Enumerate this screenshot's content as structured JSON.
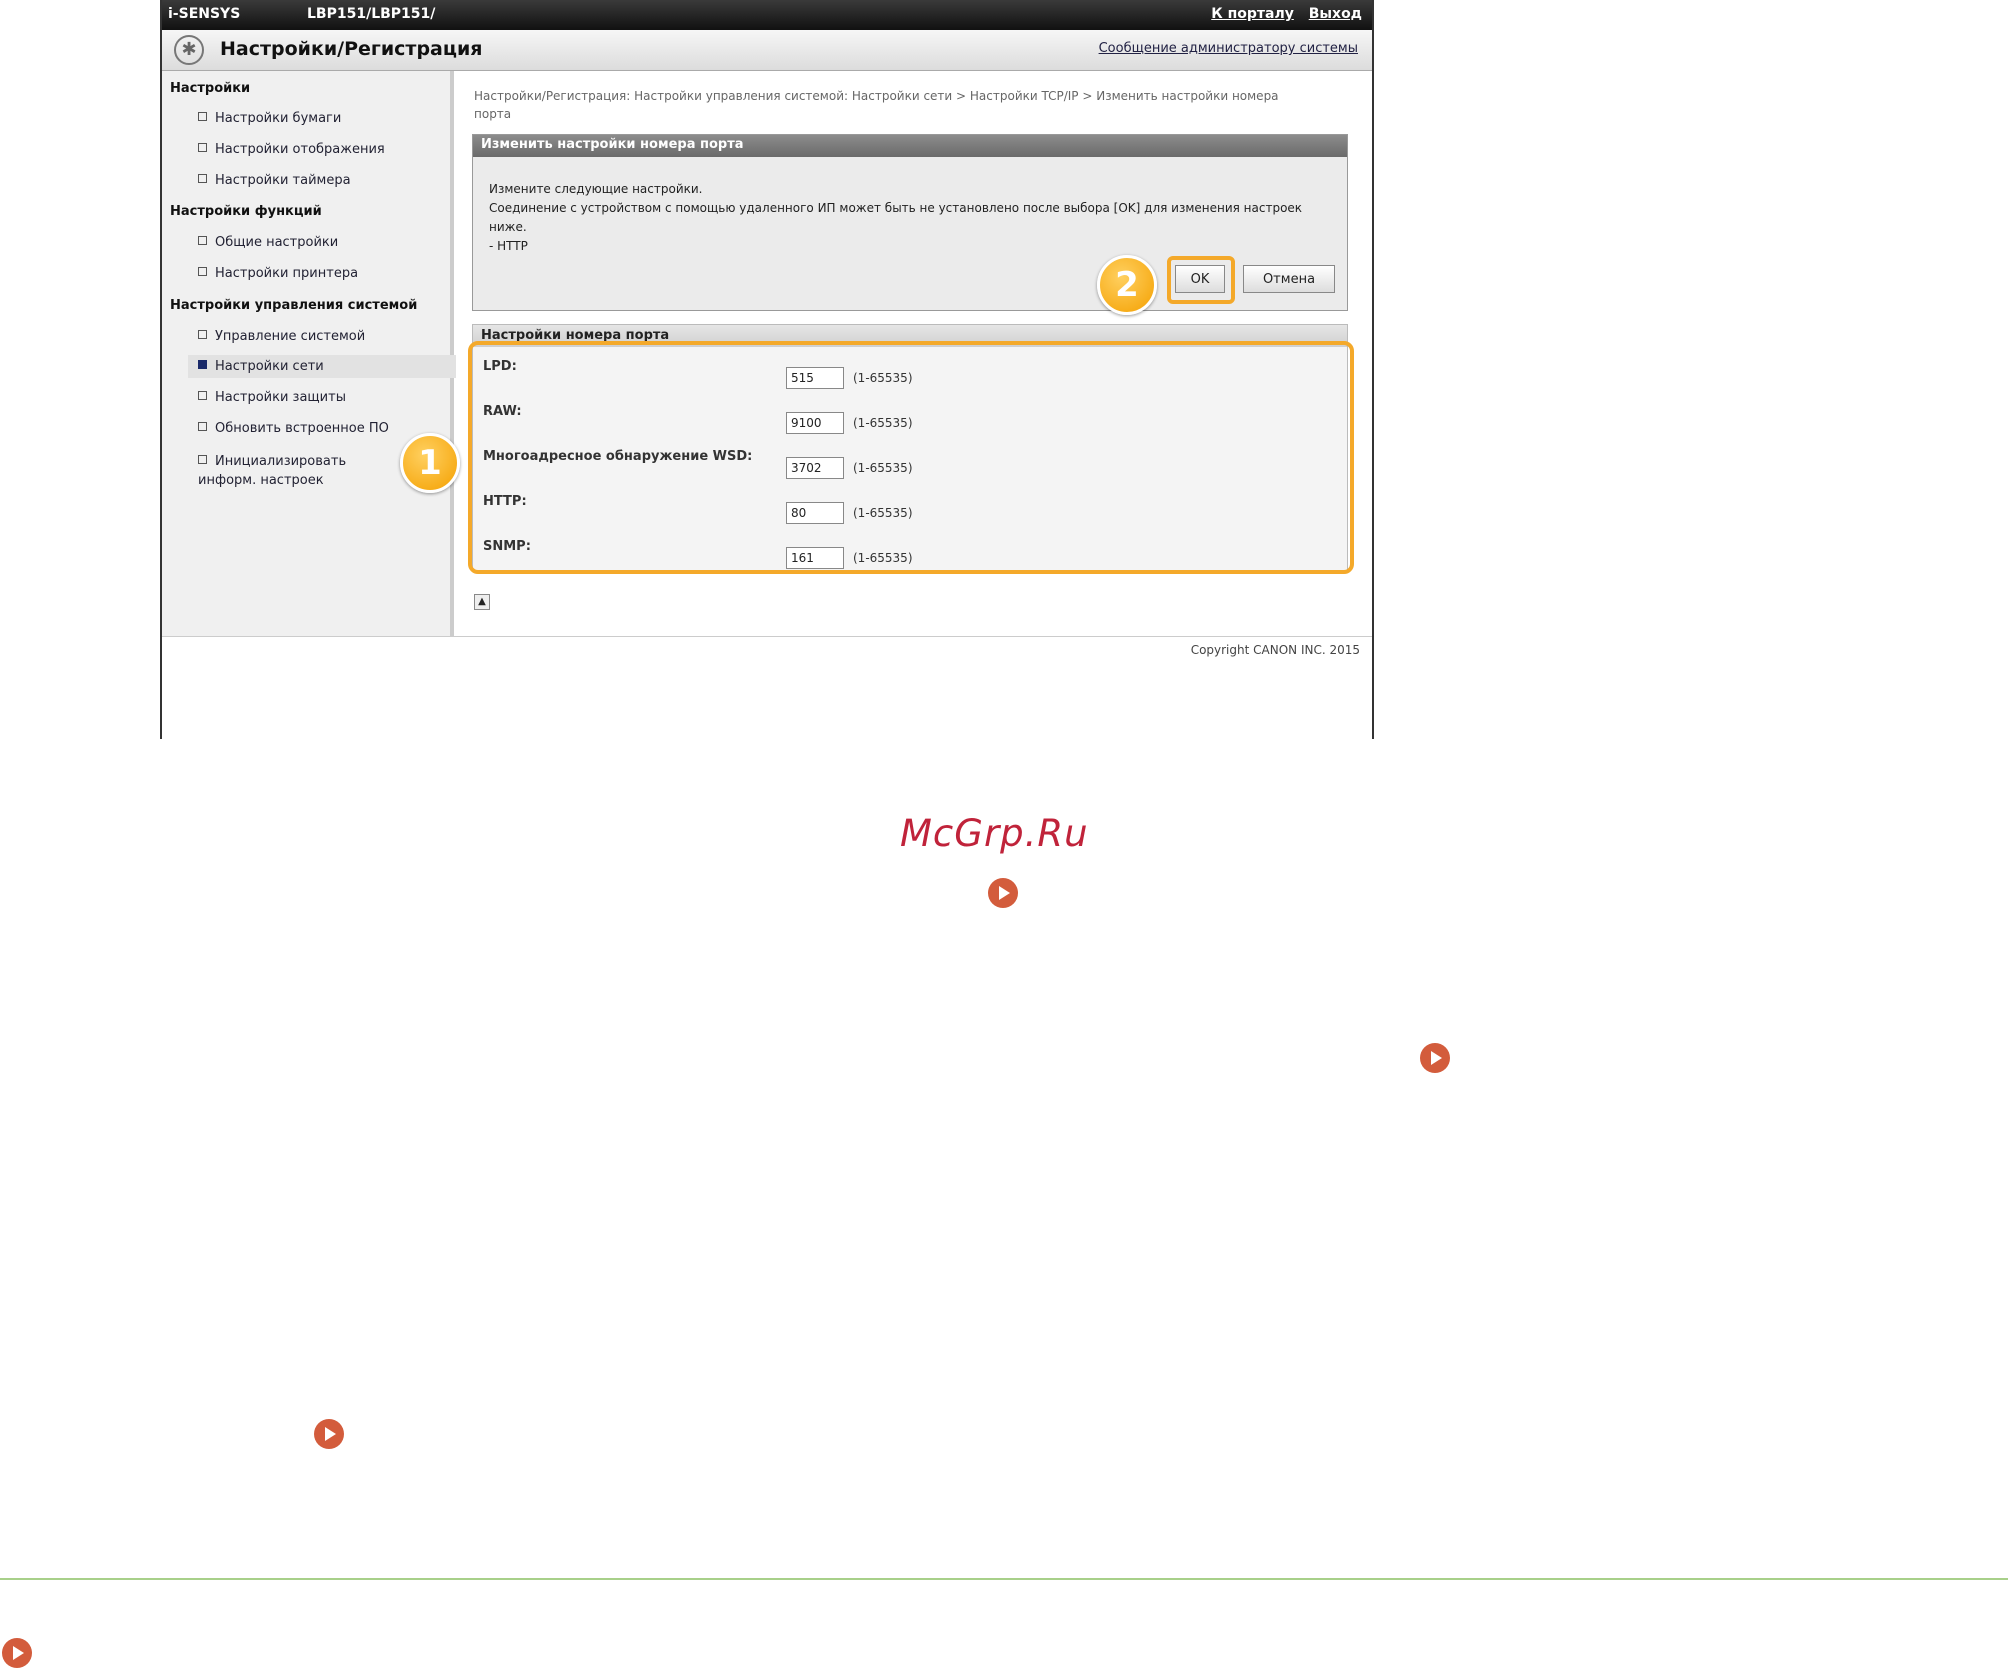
{
  "topbar": {
    "brand": "i-SENSYS",
    "model": "LBP151/LBP151/",
    "portal_link": "К порталу",
    "logout_link": "Выход"
  },
  "titlebar": {
    "title": "Настройки/Регистрация",
    "admin_link": "Сообщение администратору системы"
  },
  "sidebar": {
    "sections": [
      {
        "title": "Настройки",
        "items": [
          "Настройки бумаги",
          "Настройки отображения",
          "Настройки таймера"
        ]
      },
      {
        "title": "Настройки функций",
        "items": [
          "Общие настройки",
          "Настройки принтера"
        ]
      },
      {
        "title": "Настройки управления системой",
        "items": [
          "Управление системой",
          "Настройки сети",
          "Настройки защиты",
          "Обновить встроенное ПО",
          "Инициализировать информ. настроек"
        ]
      }
    ],
    "active_item": "Настройки сети"
  },
  "breadcrumb": "Настройки/Регистрация: Настройки управления системой: Настройки сети > Настройки TCP/IP > Изменить настройки номера порта",
  "dialog": {
    "title": "Изменить настройки номера порта",
    "line1": "Измените следующие настройки.",
    "line2": "Соединение с устройством с помощью удаленного ИП может быть не установлено после выбора [OK] для изменения настроек ниже.",
    "line3": "- HTTP",
    "ok_label": "OK",
    "cancel_label": "Отмена"
  },
  "ports": {
    "title": "Настройки номера порта",
    "rows": [
      {
        "label": "LPD:",
        "value": "515",
        "range": "(1-65535)"
      },
      {
        "label": "RAW:",
        "value": "9100",
        "range": "(1-65535)"
      },
      {
        "label": "Многоадресное обнаружение WSD:",
        "value": "3702",
        "range": "(1-65535)"
      },
      {
        "label": "HTTP:",
        "value": "80",
        "range": "(1-65535)"
      },
      {
        "label": "SNMP:",
        "value": "161",
        "range": "(1-65535)"
      }
    ]
  },
  "footer": {
    "copyright": "Copyright CANON INC. 2015"
  },
  "steps": {
    "one": "1",
    "two": "2"
  },
  "watermark": "McGrp.Ru",
  "colors": {
    "highlight": "#f4a92a",
    "play": "#d35c3c",
    "rule": "#a8d08a"
  },
  "icons": {
    "settings": "gear-icon",
    "nav": "play-arrow-icon",
    "top": "scroll-top-icon"
  }
}
